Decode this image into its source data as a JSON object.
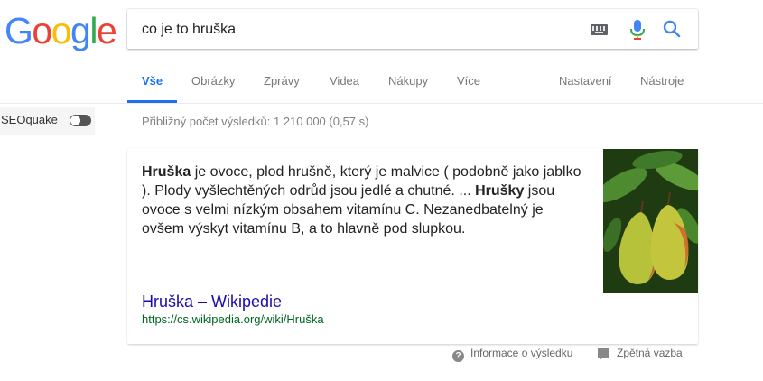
{
  "logo": {
    "text": "Google",
    "letters": [
      "G",
      "o",
      "o",
      "g",
      "l",
      "e"
    ]
  },
  "search": {
    "query": "co je to hruška"
  },
  "icons": {
    "keyboard": "keyboard-icon",
    "mic": "mic-icon",
    "search": "search-icon",
    "about": "question-circle-icon",
    "feedback": "feedback-icon"
  },
  "tabs": {
    "all": "Vše",
    "images": "Obrázky",
    "news": "Zprávy",
    "videos": "Videa",
    "shopping": "Nákupy",
    "more": "Více",
    "settings": "Nastavení",
    "tools": "Nástroje"
  },
  "seoquake": {
    "label": "SEOquake",
    "enabled": false
  },
  "result_stats": "Přibližný počet výsledků: 1 210 000 (0,57 s)",
  "snippet": {
    "bold1": "Hruška",
    "text1": " je ovoce, plod hrušně, který je malvice ( podobně jako jablko ). Plody vyšlechtěných odrůd jsou jedlé a chutné. ... ",
    "bold2": "Hrušky",
    "text2": " jsou ovoce s velmi nízkým obsahem vitamínu C. Nezanedbatelný je ovšem výskyt vitamínu B, a to hlavně pod slupkou."
  },
  "result": {
    "title": "Hruška – Wikipedie",
    "url": "https://cs.wikipedia.org/wiki/Hruška"
  },
  "footer": {
    "about": "Informace o výsledku",
    "feedback": "Zpětná vazba"
  },
  "colors": {
    "accent": "#1a73e8",
    "link": "#1a0dab",
    "url": "#006621",
    "pear_green": "#b5c23a",
    "pear_red": "#c8502a",
    "leaf": "#3f7a2a"
  }
}
